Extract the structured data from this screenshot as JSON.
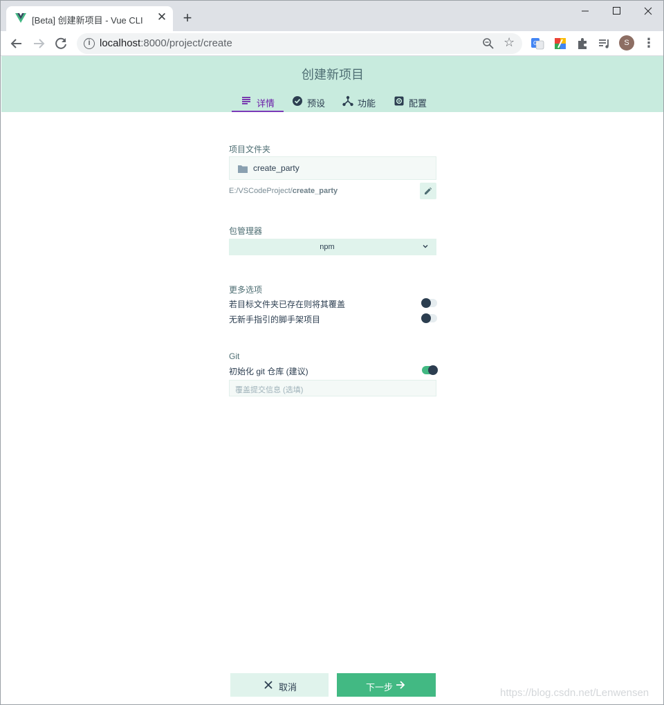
{
  "browser": {
    "tab_title": "[Beta] 创建新项目 - Vue CLI",
    "tab_close": "✕",
    "new_tab": "+",
    "url_host": "localhost",
    "url_path": ":8000/project/create",
    "avatar_letter": "S",
    "icons": [
      "vue-logo-icon",
      "back-arrow-icon",
      "forward-arrow-icon",
      "reload-icon",
      "info-icon",
      "zoom-icon",
      "star-icon",
      "translate-icon",
      "color-extension-icon",
      "puzzle-icon",
      "media-control-icon",
      "more-vert-icon"
    ]
  },
  "header": {
    "title": "创建新项目",
    "tabs": [
      {
        "label": "详情",
        "icon": "subject-icon",
        "active": true
      },
      {
        "label": "预设",
        "icon": "check-circle-icon",
        "active": false
      },
      {
        "label": "功能",
        "icon": "device-hub-icon",
        "active": false
      },
      {
        "label": "配置",
        "icon": "settings-icon",
        "active": false
      }
    ]
  },
  "form": {
    "folder_section_label": "项目文件夹",
    "folder_name": "create_party",
    "folder_path_prefix": "E:/VSCodeProject/",
    "folder_path_name": "create_party",
    "package_manager_label": "包管理器",
    "package_manager_value": "npm",
    "more_options_label": "更多选项",
    "options": [
      {
        "label": "若目标文件夹已存在则将其覆盖",
        "enabled": false
      },
      {
        "label": "无新手指引的脚手架项目",
        "enabled": false
      }
    ],
    "git_label": "Git",
    "git_init_label": "初始化 git 仓库 (建议)",
    "git_init_enabled": true,
    "commit_placeholder": "覆盖提交信息 (选填)"
  },
  "footer": {
    "cancel_label": "取消",
    "next_label": "下一步"
  },
  "watermark": "https://blog.csdn.net/Lenwensen",
  "colors": {
    "header_bg": "#c8ebde",
    "accent_green": "#42b983",
    "active_tab": "#6b1ea8",
    "dark": "#2c3e50"
  }
}
